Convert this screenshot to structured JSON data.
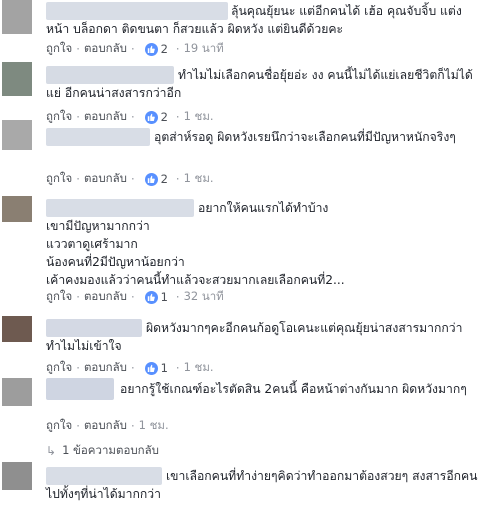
{
  "comments": [
    {
      "text": "ลุ้นคุณยุ้ยนะ แต่อีกคนได้ เฮ้อ คุณจับจิ้บ แต่งหน้า บล็อกดา ติดขนตา ก็สวยแล้ว ผิดหวัง แต่ยินดีด้วยคะ",
      "like": "ถูกใจ",
      "reply": "ตอบกลับ",
      "count": "2",
      "time": "19 นาที",
      "avatar_color": "#9a9a9a",
      "name_blur_color": "#d8dde6"
    },
    {
      "text": "ทำไมไม่เลือกคนชื่อยุ้ยอ่ะ งง คนนี้ไม่ได้แย่เลยชีวิตก็ไม่ได้แย่ อีกคนน่าสงสารกว่าอีก",
      "like": "ถูกใจ",
      "reply": "ตอบกลับ",
      "count": "2",
      "time": "1 ชม.",
      "avatar_color": "#7e8a80",
      "name_blur_color": "#d6dbe4"
    },
    {
      "text": "อุตส่าห์รอดู ผิดหวังเรยนึกว่าจะเลือกคนที่มีปัญหาหนักจริงๆ",
      "like": "ถูกใจ",
      "reply": "ตอบกลับ",
      "count": "2",
      "time": "1 ชม.",
      "avatar_color": "#a9a9a9",
      "name_blur_color": "#d8dde6"
    },
    {
      "text": "อยากให้คนแรกได้ทำบ้าง\nเขามีปัญหามากกว่า\nแววตาดูเศร้ามาก\nน้องคนที่2มีปัญหาน้อยกว่า\nเค้าคงมองแล้วว่าคนนี้ทำแล้วจะสวยมากเลยเลือกคนที่2...",
      "like": "ถูกใจ",
      "reply": "ตอบกลับ",
      "count": "1",
      "time": "32 นาที",
      "avatar_color": "#8a7f72",
      "name_blur_color": "#d8dde6"
    },
    {
      "text": "ผิดหวังมากๆคะอีกคนก้อดูโอเคนะแต่คุณยุ้ยน่าสงสารมากกว่าทำไมไม่เข้าใจ",
      "like": "ถูกใจ",
      "reply": "ตอบกลับ",
      "count": "1",
      "time": "1 ชม.",
      "avatar_color": "#6e5a50",
      "name_blur_color": "#d4d9e4"
    },
    {
      "text": "อยากรู้ใช้เกณฑ์อะไรตัดสิน 2คนนี้ คือหน้าต่างกันมาก ผิดหวังมากๆ",
      "like": "ถูกใจ",
      "reply": "ตอบกลับ",
      "count": "",
      "time": "1 ชม.",
      "avatar_color": "#9d9d9d",
      "name_blur_color": "#cfd5e2"
    },
    {
      "text": "เขาเลือกคนที่ทำง่ายๆคิดว่าทำออกมาต้องสวยๆ สงสารอีกคนไปทั้งๆที่น่าได้มากกว่า",
      "like": "",
      "reply": "",
      "count": "",
      "time": "",
      "avatar_color": "#8f8f8f",
      "name_blur_color": "#d8dde6"
    }
  ],
  "replies_link": "1 ข้อความตอบกลับ"
}
